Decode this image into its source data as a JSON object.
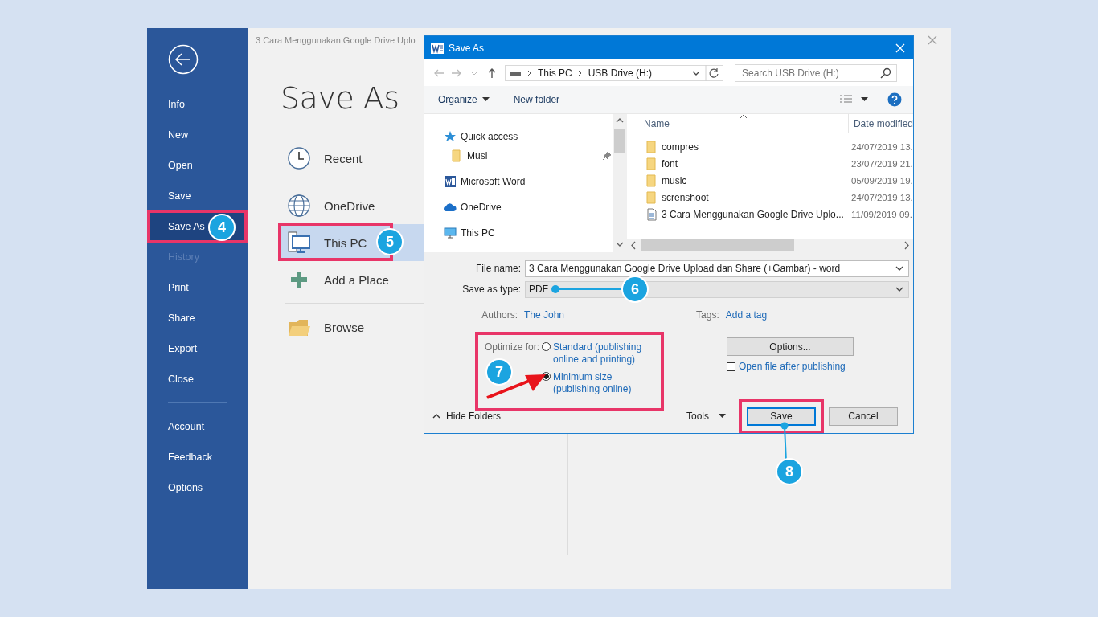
{
  "backstage": {
    "doc_title": "3 Cara Menggunakan Google Drive Uplo",
    "nav": [
      {
        "label": "Info",
        "selected": false,
        "disabled": false
      },
      {
        "label": "New",
        "selected": false,
        "disabled": false
      },
      {
        "label": "Open",
        "selected": false,
        "disabled": false
      },
      {
        "label": "Save",
        "selected": false,
        "disabled": false
      },
      {
        "label": "Save As",
        "selected": true,
        "disabled": false,
        "highlighted": true,
        "badge": "4"
      },
      {
        "label": "History",
        "selected": false,
        "disabled": true
      },
      {
        "label": "Print",
        "selected": false,
        "disabled": false
      },
      {
        "label": "Share",
        "selected": false,
        "disabled": false
      },
      {
        "label": "Export",
        "selected": false,
        "disabled": false
      },
      {
        "label": "Close",
        "selected": false,
        "disabled": false
      }
    ],
    "nav_bottom": [
      {
        "label": "Account",
        "selected": false,
        "disabled": false
      },
      {
        "label": "Feedback",
        "selected": false,
        "disabled": false
      },
      {
        "label": "Options",
        "selected": false,
        "disabled": false
      }
    ],
    "heading": "Save As",
    "places": [
      {
        "kind": "clock",
        "label": "Recent",
        "selected": false
      },
      {
        "kind": "globe",
        "label": "OneDrive",
        "selected": false
      },
      {
        "kind": "pc",
        "label": "This PC",
        "selected": true,
        "highlighted": true,
        "badge": "5"
      },
      {
        "kind": "plus",
        "label": "Add a Place",
        "selected": false
      },
      {
        "kind": "folder",
        "label": "Browse",
        "selected": false
      }
    ]
  },
  "dialog": {
    "title": "Save As",
    "breadcrumb": [
      "This PC",
      "USB Drive (H:)"
    ],
    "search": {
      "placeholder": "Search USB Drive (H:)"
    },
    "toolbar": {
      "organize": "Organize",
      "new_folder": "New folder"
    },
    "nav_tree": [
      {
        "kind": "star",
        "label": "Quick access",
        "pinned": false
      },
      {
        "kind": "folder",
        "label": "Musi",
        "pinned": true
      },
      {
        "kind": "word",
        "label": "Microsoft Word",
        "pinned": false
      },
      {
        "kind": "cloud",
        "label": "OneDrive",
        "pinned": false
      },
      {
        "kind": "pc",
        "label": "This PC",
        "pinned": false
      }
    ],
    "columns": [
      "Name",
      "Date modified"
    ],
    "files": [
      {
        "kind": "folder",
        "name": "compres",
        "date": "24/07/2019 13."
      },
      {
        "kind": "folder",
        "name": "font",
        "date": "23/07/2019 21."
      },
      {
        "kind": "folder",
        "name": "music",
        "date": "05/09/2019 19."
      },
      {
        "kind": "folder",
        "name": "screnshoot",
        "date": "24/07/2019 13."
      },
      {
        "kind": "pdf",
        "name": "3 Cara Menggunakan Google Drive Uplo...",
        "date": "11/09/2019 09."
      }
    ],
    "file_name": {
      "label": "File name:",
      "value": "3 Cara Menggunakan Google Drive Upload dan Share (+Gambar) - word"
    },
    "save_as_type": {
      "label": "Save as type:",
      "value": "PDF",
      "badge": "6"
    },
    "authors": {
      "label": "Authors:",
      "value": "The John"
    },
    "tags": {
      "label": "Tags:",
      "value": "Add a tag"
    },
    "optimize": {
      "label": "Optimize for:",
      "highlighted": true,
      "badge": "7",
      "options": [
        {
          "label": "Standard (publishing online and printing)",
          "selected": false
        },
        {
          "label": "Minimum size (publishing online)",
          "selected": true
        }
      ]
    },
    "options_button": "Options...",
    "open_after": {
      "label": "Open file after publishing",
      "checked": false
    },
    "hide_folders": "Hide Folders",
    "tools": "Tools",
    "save": {
      "label": "Save",
      "highlighted": true,
      "badge": "8"
    },
    "cancel": "Cancel"
  }
}
